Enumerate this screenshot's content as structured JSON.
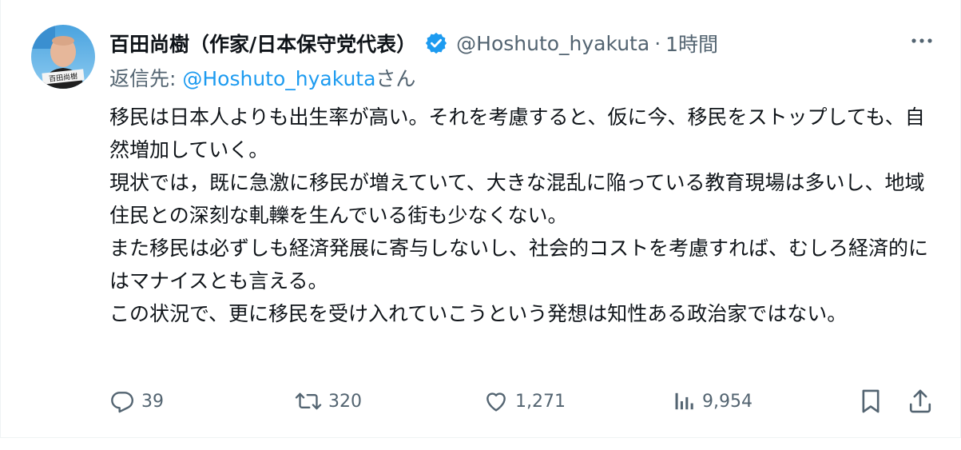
{
  "author": {
    "display_name": "百田尚樹（作家/日本保守党代表）",
    "handle": "@Hoshuto_hyakuta",
    "separator": "·",
    "time": "1時間",
    "avatar_text": "百田尚樹"
  },
  "reply": {
    "prefix": "返信先: ",
    "mention": "@Hoshuto_hyakuta",
    "suffix": "さん"
  },
  "body": {
    "paragraphs": [
      "移民は日本人よりも出生率が高い。それを考慮すると、仮に今、移民をストップしても、自然増加していく。",
      "現状では，既に急激に移民が増えていて、大きな混乱に陥っている教育現場は多いし、地域住民との深刻な軋轢を生んでいる街も少なくない。",
      "また移民は必ずしも経済発展に寄与しないし、社会的コストを考慮すれば、むしろ経済的にはマナイスとも言える。",
      "この状況で、更に移民を受け入れていこうという発想は知性ある政治家ではない。"
    ]
  },
  "actions": {
    "replies": "39",
    "reposts": "320",
    "likes": "1,271",
    "views": "9,954"
  },
  "icons": {
    "verified": "verified-badge-icon",
    "more": "more-icon",
    "reply": "reply-icon",
    "repost": "repost-icon",
    "like": "heart-icon",
    "views": "views-icon",
    "bookmark": "bookmark-icon",
    "share": "share-icon"
  },
  "colors": {
    "text": "#0f1419",
    "secondary": "#536471",
    "link": "#1d9bf0",
    "verified": "#1d9bf0"
  }
}
